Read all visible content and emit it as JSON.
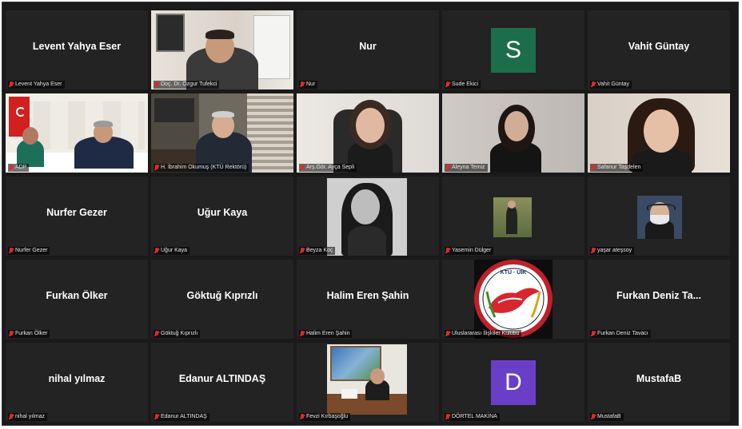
{
  "tiles": [
    {
      "name": "Levent Yahya Eser",
      "label": "Levent Yahya Eser"
    },
    {
      "name": "",
      "label": "Doç. Dr. Ozgur Tufekci"
    },
    {
      "name": "Nur",
      "label": "Nur"
    },
    {
      "name": "",
      "label": "Sude Ekici",
      "letter": "S",
      "letter_color": "#1c6e4b"
    },
    {
      "name": "Vahit Güntay",
      "label": "Vahit Güntay"
    },
    {
      "name": "",
      "label": "ADP"
    },
    {
      "name": "",
      "label": "H. İbrahim Okumuş (KTÜ Rektörü)"
    },
    {
      "name": "",
      "label": "Arş.Gör. Ayça Sepli"
    },
    {
      "name": "",
      "label": "Aleyna Temiz"
    },
    {
      "name": "",
      "label": "Safanur Taşdelen"
    },
    {
      "name": "Nurfer Gezer",
      "label": "Nurfer Gezer"
    },
    {
      "name": "Uğur Kaya",
      "label": "Uğur Kaya"
    },
    {
      "name": "",
      "label": "Beyza Koç"
    },
    {
      "name": "",
      "label": "Yasemin Dülger"
    },
    {
      "name": "",
      "label": "yaşar ateşsoy"
    },
    {
      "name": "Furkan Ölker",
      "label": "Furkan Ölker"
    },
    {
      "name": "Göktuğ Kıprızlı",
      "label": "Göktuğ Kıprızlı"
    },
    {
      "name": "Halim Eren Şahin",
      "label": "Halim Eren Şahin"
    },
    {
      "name": "",
      "label": "Uluslararası İlişkiler Kulübü",
      "logo_text": "KTÜ · UİK"
    },
    {
      "name": "Furkan Deniz Ta...",
      "label": "Furkan Deniz Tavacı"
    },
    {
      "name": "nihal yılmaz",
      "label": "nihal yılmaz"
    },
    {
      "name": "Edanur ALTINDAŞ",
      "label": "Edanur ALTINDAŞ"
    },
    {
      "name": "",
      "label": "Fevzi Kırbaşoğlu"
    },
    {
      "name": "",
      "label": "DÖRTEL MAKİNA",
      "letter": "D",
      "letter_color": "#6a3fc8"
    },
    {
      "name": "MustafaB",
      "label": "MustafaB"
    }
  ],
  "colors": {
    "tile_bg": "#232323",
    "active_speaker_border": "#c9e36b",
    "muted_mic": "#e02a2a"
  }
}
